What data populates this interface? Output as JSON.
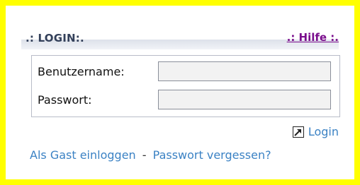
{
  "header": {
    "title": ".: LOGIN:.",
    "help_link": ".: Hilfe :."
  },
  "form": {
    "username_label": "Benutzername:",
    "username_value": "",
    "password_label": "Passwort:",
    "password_value": ""
  },
  "actions": {
    "login_label": "Login",
    "login_icon": "external-arrow-icon",
    "guest_login": "Als Gast einloggen",
    "separator": "-",
    "forgot_password": "Passwort vergessen?"
  },
  "colors": {
    "frame": "#ffff00",
    "title": "#33405a",
    "help_link": "#7a0d8c",
    "link": "#3b82c4"
  }
}
